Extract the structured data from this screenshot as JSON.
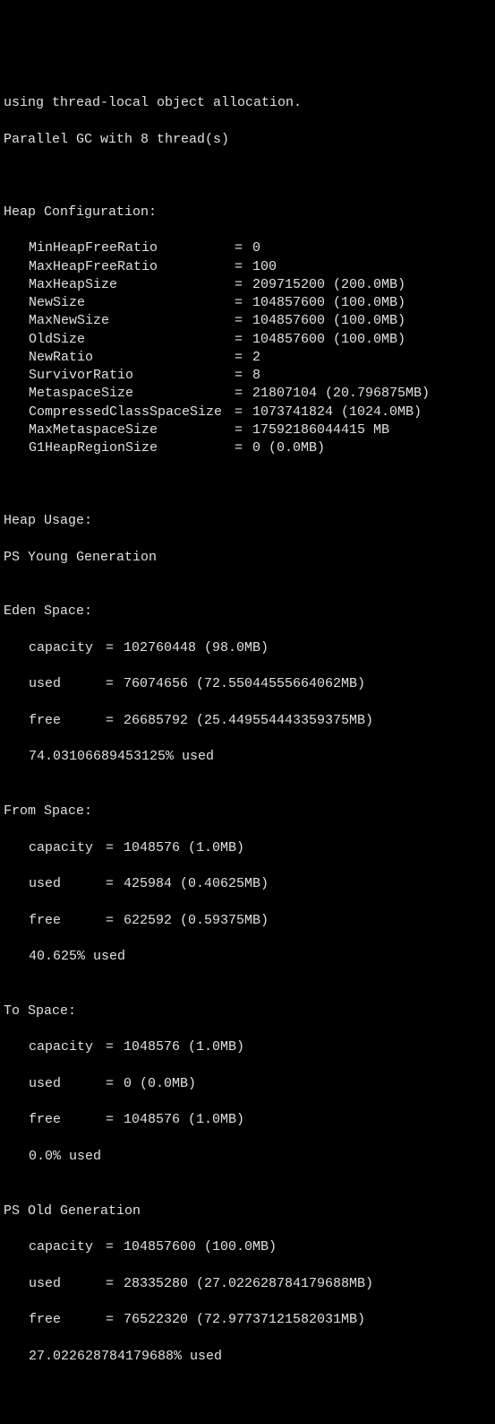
{
  "header": {
    "line1": "using thread-local object allocation.",
    "line2": "Parallel GC with 8 thread(s)"
  },
  "heap_config": {
    "title": "Heap Configuration:",
    "rows": [
      {
        "key": "MinHeapFreeRatio",
        "value": "0"
      },
      {
        "key": "MaxHeapFreeRatio",
        "value": "100"
      },
      {
        "key": "MaxHeapSize",
        "value": "209715200 (200.0MB)"
      },
      {
        "key": "NewSize",
        "value": "104857600 (100.0MB)"
      },
      {
        "key": "MaxNewSize",
        "value": "104857600 (100.0MB)"
      },
      {
        "key": "OldSize",
        "value": "104857600 (100.0MB)"
      },
      {
        "key": "NewRatio",
        "value": "2"
      },
      {
        "key": "SurvivorRatio",
        "value": "8"
      },
      {
        "key": "MetaspaceSize",
        "value": "21807104 (20.796875MB)"
      },
      {
        "key": "CompressedClassSpaceSize",
        "value": "1073741824 (1024.0MB)"
      },
      {
        "key": "MaxMetaspaceSize",
        "value": "17592186044415 MB"
      },
      {
        "key": "G1HeapRegionSize",
        "value": "0 (0.0MB)"
      }
    ]
  },
  "heap_usage": {
    "title": "Heap Usage:",
    "young_gen": "PS Young Generation",
    "eden": {
      "title": "Eden Space:",
      "capacity": "102760448 (98.0MB)",
      "used": "76074656 (72.55044555664062MB)",
      "free": "26685792 (25.449554443359375MB)",
      "pct": "74.03106689453125% used"
    },
    "from": {
      "title": "From Space:",
      "capacity": "1048576 (1.0MB)",
      "used": "425984 (0.40625MB)",
      "free": "622592 (0.59375MB)",
      "pct": "40.625% used"
    },
    "to": {
      "title": "To Space:",
      "capacity": "1048576 (1.0MB)",
      "used": "0 (0.0MB)",
      "free": "1048576 (1.0MB)",
      "pct": "0.0% used"
    },
    "old_gen": {
      "title": "PS Old Generation",
      "capacity": "104857600 (100.0MB)",
      "used": "28335280 (27.022628784179688MB)",
      "free": "76522320 (72.97737121582031MB)",
      "pct": "27.022628784179688% used"
    }
  },
  "labels": {
    "capacity": "capacity",
    "used": "used",
    "free": "free",
    "eq": "="
  }
}
